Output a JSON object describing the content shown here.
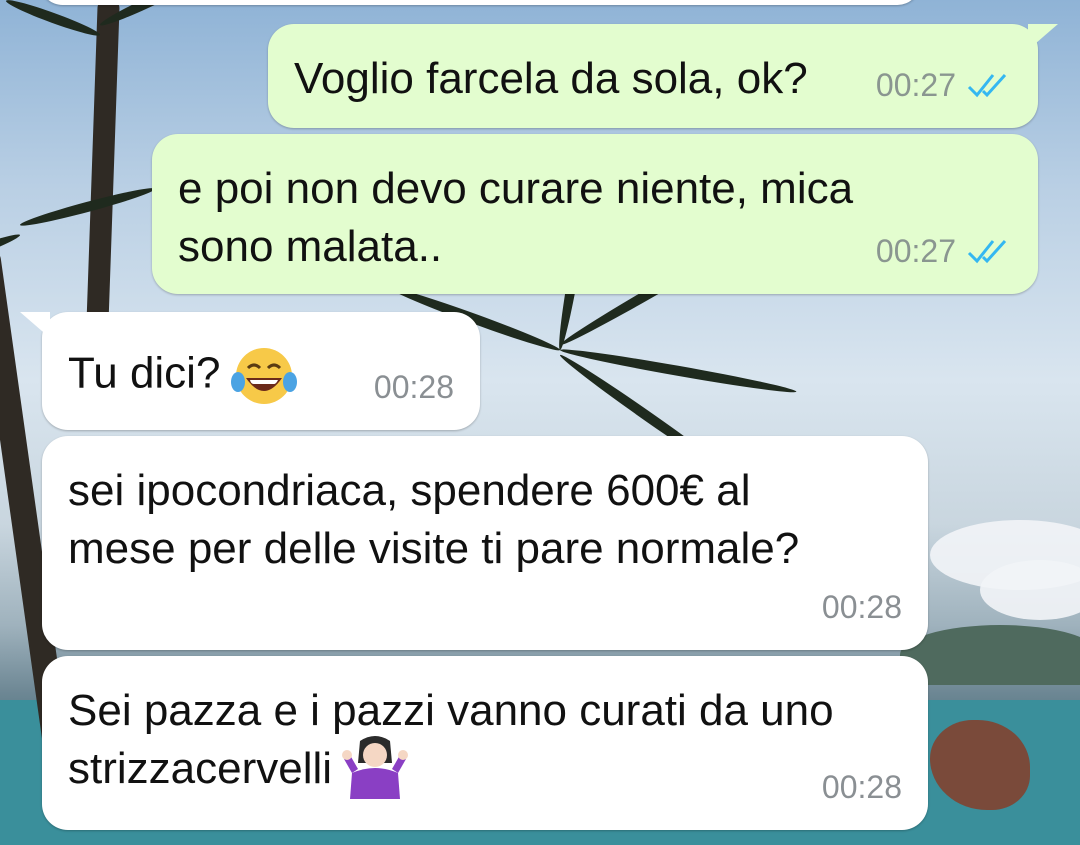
{
  "colors": {
    "outgoing_bubble": "#e3fdcf",
    "incoming_bubble": "#ffffff",
    "read_ticks": "#34b7f1",
    "timestamp": "#8a9690"
  },
  "messages": [
    {
      "direction": "outgoing",
      "text": "Voglio farcela da sola, ok?",
      "time": "00:27",
      "status_icon": "double-check-read-icon"
    },
    {
      "direction": "outgoing",
      "text": "e poi non devo curare niente, mica\nsono malata..",
      "time": "00:27",
      "status_icon": "double-check-read-icon"
    },
    {
      "direction": "incoming",
      "text": "Tu dici?",
      "emoji": "face-with-tears-of-joy-emoji",
      "time": "00:28"
    },
    {
      "direction": "incoming",
      "text": "sei ipocondriaca, spendere 600€ al\nmese per delle visite ti pare normale?",
      "time": "00:28"
    },
    {
      "direction": "incoming",
      "text": "Sei pazza e i pazzi vanno curati da uno\nstrizzacervelli",
      "emoji": "woman-shrugging-emoji",
      "time": "00:28"
    }
  ]
}
